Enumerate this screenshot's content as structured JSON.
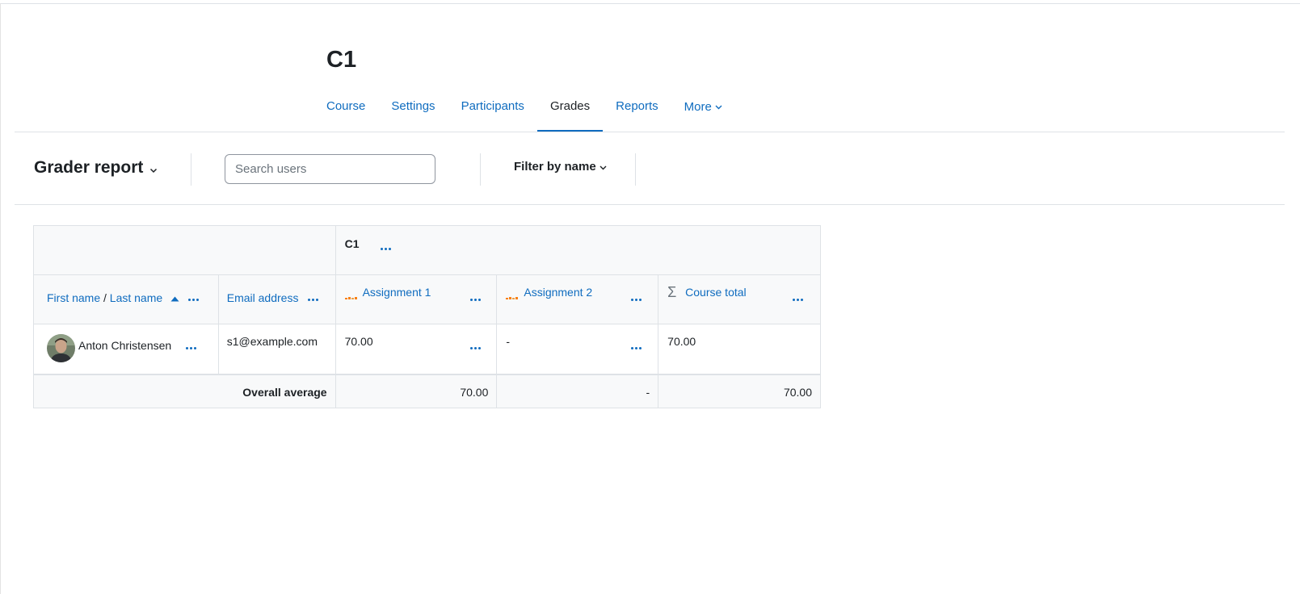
{
  "course": {
    "title": "C1"
  },
  "secondary_nav": {
    "tabs": [
      {
        "label": "Course"
      },
      {
        "label": "Settings"
      },
      {
        "label": "Participants"
      },
      {
        "label": "Grades",
        "active": true
      },
      {
        "label": "Reports"
      },
      {
        "label": "More"
      }
    ]
  },
  "tertiary_nav": {
    "report_title": "Grader report",
    "search_placeholder": "Search users",
    "filter_label": "Filter by name"
  },
  "grader_table": {
    "category_header": "C1",
    "columns": {
      "name_first": "First name",
      "name_sep": " / ",
      "name_last": "Last name",
      "email": "Email address",
      "assignment1": "Assignment 1",
      "assignment2": "Assignment 2",
      "course_total": "Course total"
    },
    "rows": [
      {
        "name": "Anton Christensen",
        "email": "s1@example.com",
        "assignment1": "70.00",
        "assignment2": "-",
        "course_total": "70.00"
      }
    ],
    "overall_average": {
      "label": "Overall average",
      "assignment1": "70.00",
      "assignment2": "-",
      "course_total": "70.00"
    }
  },
  "colors": {
    "link": "#0f6cbf",
    "active_underline": "#0f6cbf",
    "header_bg": "#f8f9fa"
  }
}
